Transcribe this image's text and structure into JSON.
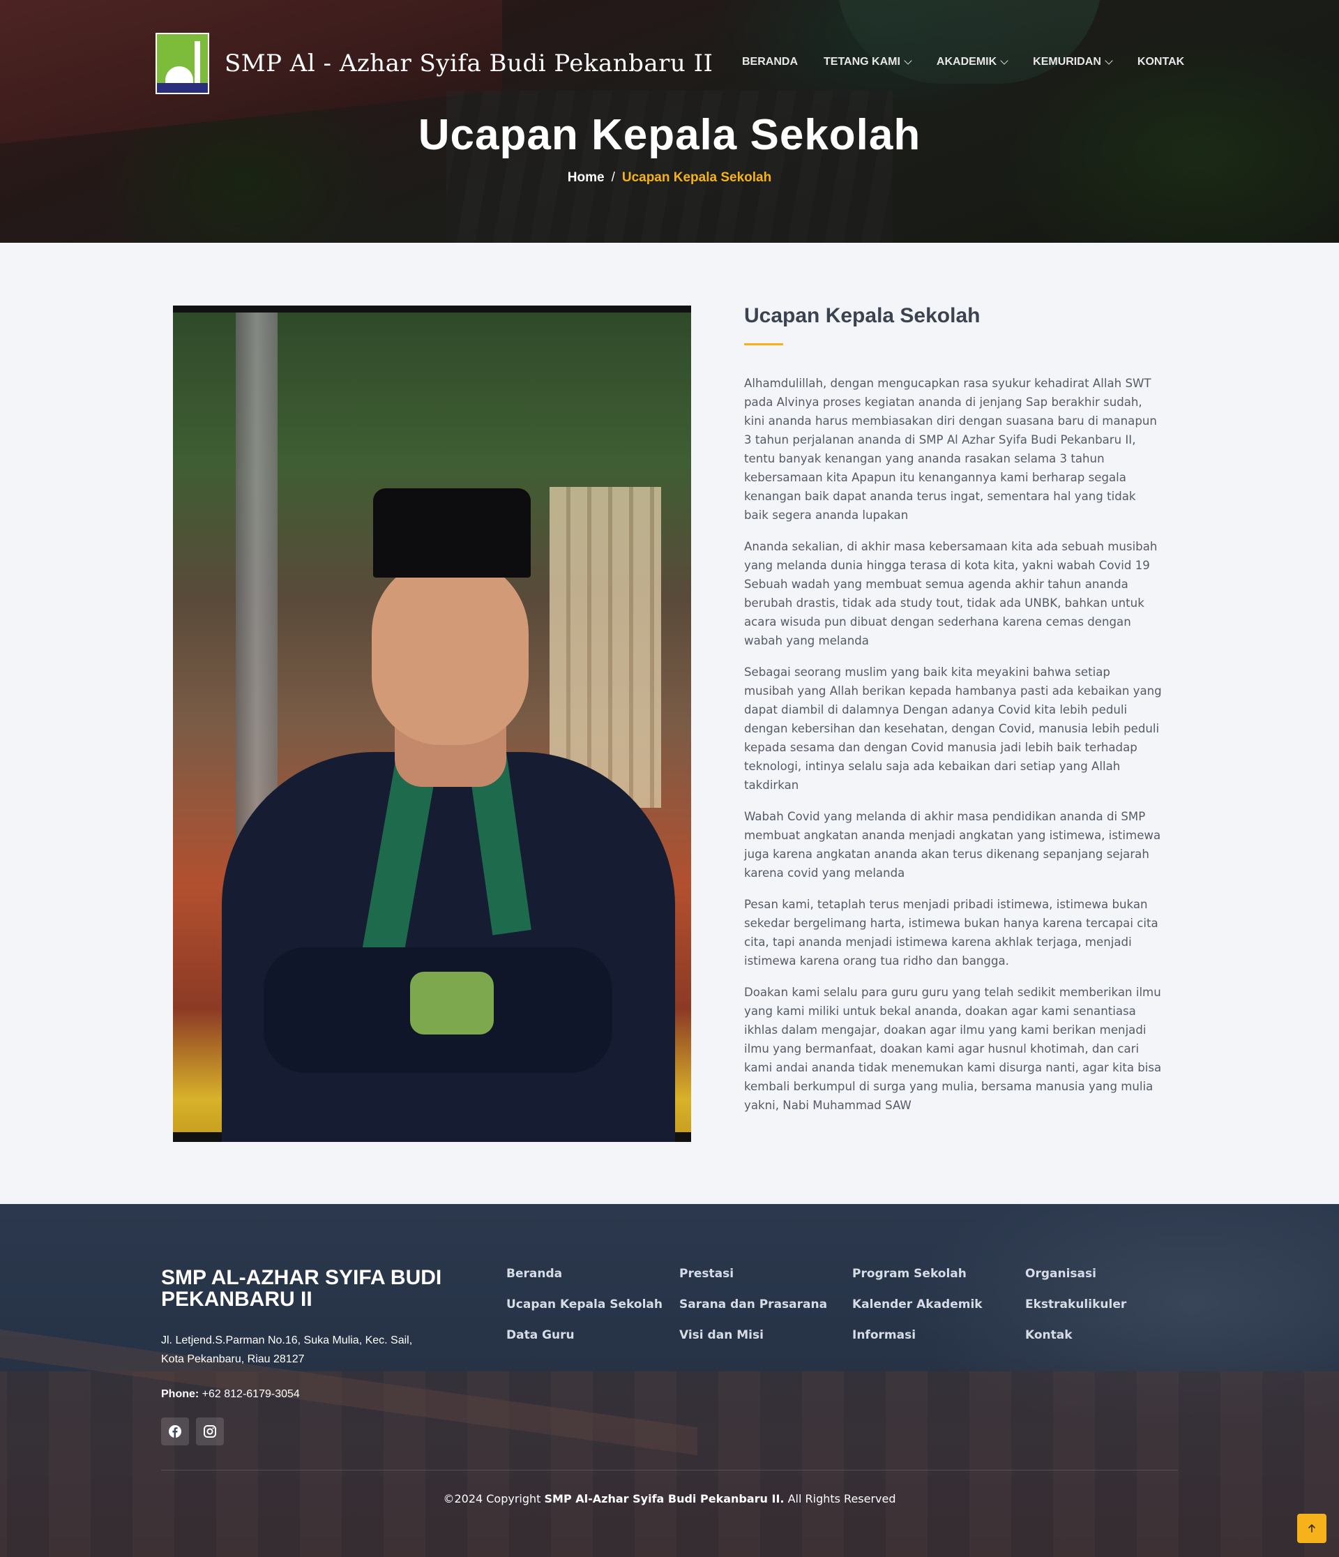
{
  "brand": {
    "name": "SMP Al - Azhar Syifa Budi Pekanbaru II"
  },
  "nav": {
    "items": [
      {
        "label": "BERANDA",
        "has_dropdown": false
      },
      {
        "label": "TETANG KAMI",
        "has_dropdown": true
      },
      {
        "label": "AKADEMIK",
        "has_dropdown": true
      },
      {
        "label": "KEMURIDAN",
        "has_dropdown": true
      },
      {
        "label": "KONTAK",
        "has_dropdown": false
      }
    ]
  },
  "hero": {
    "title": "Ucapan Kepala Sekolah",
    "breadcrumb": {
      "home": "Home",
      "separator": "/",
      "current": "Ucapan Kepala Sekolah"
    }
  },
  "article": {
    "heading": "Ucapan Kepala Sekolah",
    "paragraphs": [
      "Alhamdulillah, dengan mengucapkan rasa syukur kehadirat Allah SWT pada Alvinya proses kegiatan ananda di jenjang Sap berakhir sudah, kini ananda harus membiasakan diri dengan suasana baru di manapun 3 tahun perjalanan ananda di SMP Al Azhar Syifa Budi Pekanbaru II, tentu banyak kenangan yang ananda rasakan selama 3 tahun kebersamaan kita Apapun itu kenangannya kami berharap segala kenangan baik dapat ananda terus ingat, sementara hal yang tidak baik segera ananda lupakan",
      "Ananda sekalian, di akhir masa kebersamaan kita ada sebuah musibah yang melanda dunia hingga terasa di kota kita, yakni wabah Covid 19 Sebuah wadah yang membuat semua agenda akhir tahun ananda berubah drastis, tidak ada study tout, tidak ada UNBK, bahkan untuk acara wisuda pun dibuat dengan sederhana karena cemas dengan wabah yang melanda",
      "Sebagai seorang muslim yang baik kita meyakini bahwa setiap musibah yang Allah berikan kepada hambanya pasti ada kebaikan yang dapat diambil di dalamnya Dengan adanya Covid kita lebih peduli dengan kebersihan dan kesehatan, dengan Covid, manusia lebih peduli kepada sesama dan dengan Covid manusia jadi lebih baik terhadap teknologi, intinya selalu saja ada kebaikan dari setiap yang Allah takdirkan",
      "Wabah Covid yang melanda di akhir masa pendidikan ananda di SMP membuat angkatan ananda menjadi angkatan yang istimewa, istimewa juga karena angkatan ananda akan terus dikenang sepanjang sejarah karena covid yang melanda",
      "Pesan kami, tetaplah terus menjadi pribadi istimewa, istimewa bukan sekedar bergelimang harta, istimewa bukan hanya karena tercapai cita cita, tapi ananda menjadi istimewa karena akhlak terjaga, menjadi istimewa karena orang tua ridho dan bangga.",
      "Doakan kami selalu para guru guru yang telah sedikit memberikan ilmu yang kami miliki untuk bekal ananda, doakan agar kami senantiasa ikhlas dalam mengajar, doakan agar ilmu yang kami berikan menjadi ilmu yang bermanfaat, doakan kami agar husnul khotimah, dan cari kami andai ananda tidak menemukan kami disurga nanti, agar kita bisa kembali berkumpul di surga yang mulia, bersama manusia yang mulia yakni, Nabi Muhammad SAW"
    ]
  },
  "footer": {
    "school_name": "SMP AL-AZHAR SYIFA BUDI PEKANBARU II",
    "address_line1": "Jl. Letjend.S.Parman No.16, Suka Mulia, Kec. Sail,",
    "address_line2": "Kota Pekanbaru, Riau 28127",
    "phone_label": "Phone:",
    "phone_value": "+62 812-6179-3054",
    "links": [
      "Beranda",
      "Prestasi",
      "Program Sekolah",
      "Organisasi",
      "Ucapan Kepala Sekolah",
      "Sarana dan Prasarana",
      "Kalender Akademik",
      "Ekstrakulikuler",
      "Data Guru",
      "Visi dan Misi",
      "Informasi",
      "Kontak"
    ],
    "copyright_prefix": "©2024 Copyright",
    "copyright_brand": "SMP Al-Azhar Syifa Budi Pekanbaru II.",
    "copyright_suffix": "All Rights Reserved"
  },
  "icons": {
    "social": [
      "facebook-icon",
      "instagram-icon"
    ],
    "back_to_top": "arrow-up-icon"
  },
  "colors": {
    "accent": "#f5b21b",
    "heading": "#3b4350",
    "body_text": "#555b66",
    "page_bg": "#f3f5f8"
  }
}
